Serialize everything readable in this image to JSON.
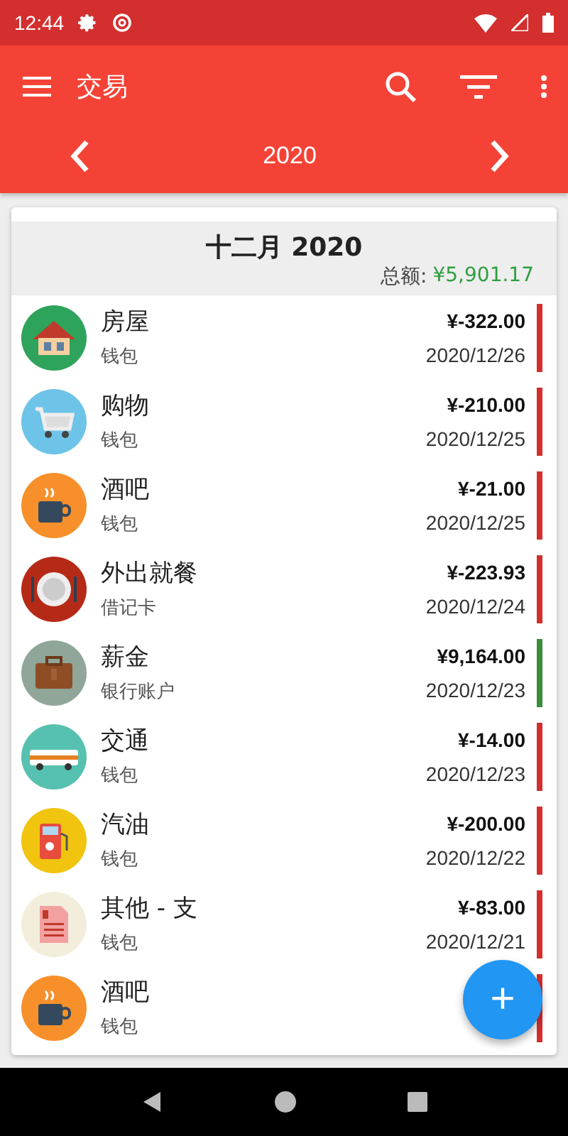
{
  "status_bar": {
    "time": "12:44"
  },
  "toolbar": {
    "title": "交易"
  },
  "year_nav": {
    "year": "2020"
  },
  "month_header": {
    "title": "十二月 2020",
    "total_label": "总额:",
    "total_value": "¥5,901.17"
  },
  "transactions": [
    {
      "category": "房屋",
      "account": "钱包",
      "amount": "¥-322.00",
      "date": "2020/12/26",
      "kind": "house",
      "color": "#d32f2f"
    },
    {
      "category": "购物",
      "account": "钱包",
      "amount": "¥-210.00",
      "date": "2020/12/25",
      "kind": "cart",
      "color": "#d32f2f"
    },
    {
      "category": "酒吧",
      "account": "钱包",
      "amount": "¥-21.00",
      "date": "2020/12/25",
      "kind": "cup",
      "color": "#d32f2f"
    },
    {
      "category": "外出就餐",
      "account": "借记卡",
      "amount": "¥-223.93",
      "date": "2020/12/24",
      "kind": "plate",
      "color": "#d32f2f"
    },
    {
      "category": "薪金",
      "account": "银行账户",
      "amount": "¥9,164.00",
      "date": "2020/12/23",
      "kind": "briefcase",
      "color": "#388e3c"
    },
    {
      "category": "交通",
      "account": "钱包",
      "amount": "¥-14.00",
      "date": "2020/12/23",
      "kind": "bus",
      "color": "#d32f2f"
    },
    {
      "category": "汽油",
      "account": "钱包",
      "amount": "¥-200.00",
      "date": "2020/12/22",
      "kind": "fuel",
      "color": "#d32f2f"
    },
    {
      "category": "其他 - 支",
      "account": "钱包",
      "amount": "¥-83.00",
      "date": "2020/12/21",
      "kind": "document",
      "color": "#d32f2f"
    },
    {
      "category": "酒吧",
      "account": "钱包",
      "kind": "cup",
      "color": "#d32f2f"
    }
  ],
  "fab": {
    "label": "+"
  }
}
